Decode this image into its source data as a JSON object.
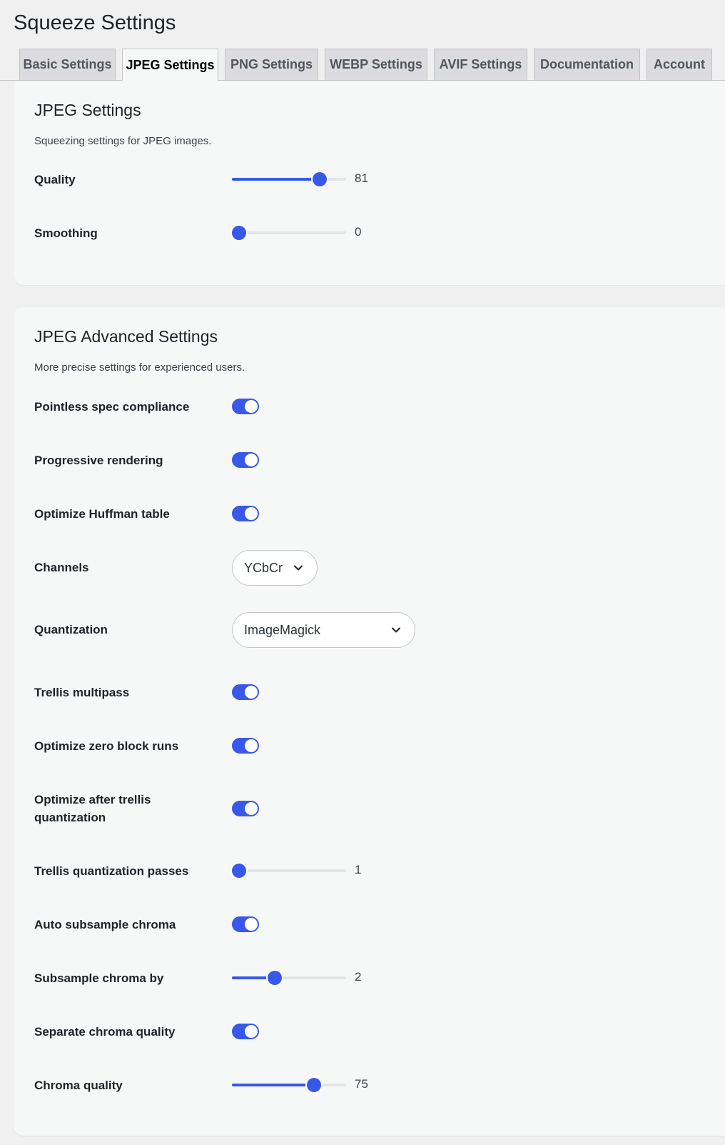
{
  "page": {
    "title": "Squeeze Settings"
  },
  "tabs": [
    {
      "label": "Basic Settings",
      "active": false
    },
    {
      "label": "JPEG Settings",
      "active": true
    },
    {
      "label": "PNG Settings",
      "active": false
    },
    {
      "label": "WEBP Settings",
      "active": false
    },
    {
      "label": "AVIF Settings",
      "active": false
    },
    {
      "label": "Documentation",
      "active": false
    },
    {
      "label": "Account",
      "active": false
    }
  ],
  "jpeg_settings": {
    "title": "JPEG Settings",
    "description": "Squeezing settings for JPEG images.",
    "quality": {
      "label": "Quality",
      "value": "81",
      "fraction": 0.81
    },
    "smoothing": {
      "label": "Smoothing",
      "value": "0",
      "fraction": 0.0
    }
  },
  "advanced": {
    "title": "JPEG Advanced Settings",
    "description": "More precise settings for experienced users.",
    "pointless_spec": {
      "label": "Pointless spec compliance",
      "on": true
    },
    "progressive": {
      "label": "Progressive rendering",
      "on": true
    },
    "huffman": {
      "label": "Optimize Huffman table",
      "on": true
    },
    "channels": {
      "label": "Channels",
      "selected": "YCbCr"
    },
    "quantization": {
      "label": "Quantization",
      "selected": "ImageMagick"
    },
    "trellis_multipass": {
      "label": "Trellis multipass",
      "on": true
    },
    "zero_block": {
      "label": "Optimize zero block runs",
      "on": true
    },
    "after_trellis": {
      "label": "Optimize after trellis quantization",
      "on": true
    },
    "trellis_passes": {
      "label": "Trellis quantization passes",
      "value": "1",
      "fraction": 0.0
    },
    "auto_subsample": {
      "label": "Auto subsample chroma",
      "on": true
    },
    "subsample_by": {
      "label": "Subsample chroma by",
      "value": "2",
      "fraction": 0.36
    },
    "separate_chroma": {
      "label": "Separate chroma quality",
      "on": true
    },
    "chroma_quality": {
      "label": "Chroma quality",
      "value": "75",
      "fraction": 0.75
    }
  },
  "colors": {
    "accent": "#3858e9",
    "background": "#f0f0f1",
    "card": "#f6f7f7"
  },
  "icons": {
    "select_arrow": "chevron-down-icon"
  }
}
